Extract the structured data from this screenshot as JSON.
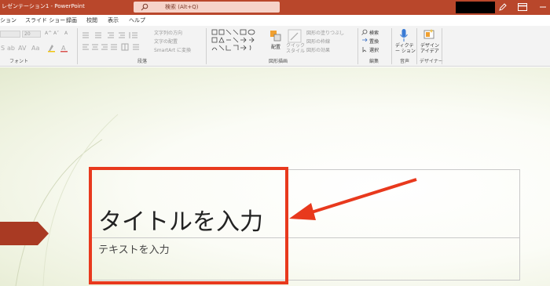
{
  "window": {
    "title": "レゼンテーション1 - PowerPoint"
  },
  "search": {
    "placeholder": "検索 (Alt+Q)"
  },
  "tabs": [
    {
      "label": "ション"
    },
    {
      "label": "スライド ショー"
    },
    {
      "label": "録画"
    },
    {
      "label": "校閲"
    },
    {
      "label": "表示"
    },
    {
      "label": "ヘルプ"
    }
  ],
  "ribbon": {
    "font": {
      "label": "フォント",
      "size_value": "20",
      "grow_label": "A^",
      "shrink_label": "A˅",
      "clear_label": "A"
    },
    "paragraph": {
      "label": "段落",
      "text_direction": "文字列の方向",
      "align_text": "文字の配置",
      "smartart": "SmartArt に変換"
    },
    "drawing": {
      "label": "図形描画",
      "arrange": "配置",
      "quick_styles": "クイック スタイル",
      "shape_fill": "図形の塗りつぶし",
      "shape_outline": "図形の枠線",
      "shape_effects": "図形の効果"
    },
    "editing": {
      "label": "編集",
      "find": "検索",
      "replace": "置換",
      "select": "選択"
    },
    "voice": {
      "label": "音声",
      "dictate": "ディクテー ション"
    },
    "designer": {
      "label": "デザイナー",
      "design_ideas": "デザイン アイデア"
    }
  },
  "slide": {
    "title": "タイトルを入力",
    "subtitle": "テキストを入力"
  },
  "colors": {
    "titlebar": "#b9472b",
    "annotation": "#e8391d"
  }
}
